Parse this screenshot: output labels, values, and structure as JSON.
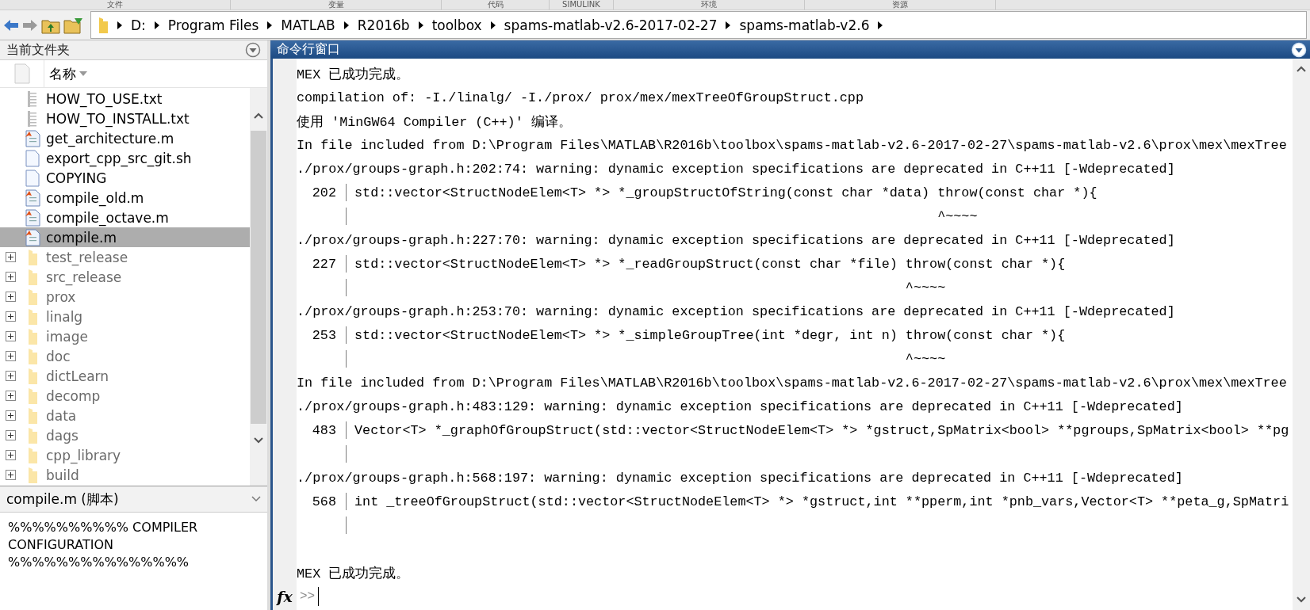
{
  "ribbon_tabs": [
    "文件",
    "变量",
    "代码",
    "SIMULINK",
    "环境",
    "资源"
  ],
  "address_bar": {
    "segments": [
      "D:",
      "Program Files",
      "MATLAB",
      "R2016b",
      "toolbox",
      "spams-matlab-v2.6-2017-02-27",
      "spams-matlab-v2.6"
    ]
  },
  "current_folder": {
    "title": "当前文件夹",
    "column": "名称",
    "items": [
      {
        "name": "HOW_TO_USE.txt",
        "kind": "text",
        "selected": false
      },
      {
        "name": "HOW_TO_INSTALL.txt",
        "kind": "text",
        "selected": false
      },
      {
        "name": "get_architecture.m",
        "kind": "mfile",
        "selected": false
      },
      {
        "name": "export_cpp_src_git.sh",
        "kind": "file",
        "selected": false
      },
      {
        "name": "COPYING",
        "kind": "file",
        "selected": false
      },
      {
        "name": "compile_old.m",
        "kind": "mfile",
        "selected": false
      },
      {
        "name": "compile_octave.m",
        "kind": "mfile",
        "selected": false
      },
      {
        "name": "compile.m",
        "kind": "mfile",
        "selected": true
      },
      {
        "name": "test_release",
        "kind": "folder",
        "selected": false,
        "expanded": false
      },
      {
        "name": "src_release",
        "kind": "folder",
        "selected": false,
        "expanded": false
      },
      {
        "name": "prox",
        "kind": "folder",
        "selected": false,
        "expanded": false
      },
      {
        "name": "linalg",
        "kind": "folder",
        "selected": false,
        "expanded": false
      },
      {
        "name": "image",
        "kind": "folder",
        "selected": false,
        "expanded": false
      },
      {
        "name": "doc",
        "kind": "folder",
        "selected": false,
        "expanded": false
      },
      {
        "name": "dictLearn",
        "kind": "folder",
        "selected": false,
        "expanded": false
      },
      {
        "name": "decomp",
        "kind": "folder",
        "selected": false,
        "expanded": false
      },
      {
        "name": "data",
        "kind": "folder",
        "selected": false,
        "expanded": false
      },
      {
        "name": "dags",
        "kind": "folder",
        "selected": false,
        "expanded": false
      },
      {
        "name": "cpp_library",
        "kind": "folder",
        "selected": false,
        "expanded": false
      },
      {
        "name": "build",
        "kind": "folder",
        "selected": false,
        "expanded": false
      }
    ]
  },
  "details": {
    "title": "compile.m (脚本)",
    "content": "%%%%%%%%%% COMPILER CONFIGURATION %%%%%%%%%%%%%%%"
  },
  "command_window": {
    "title": "命令行窗口",
    "lines": [
      {
        "kind": "text",
        "text": "MEX 已成功完成。"
      },
      {
        "kind": "text",
        "text": "compilation of: -I./linalg/ -I./prox/ prox/mex/mexTreeOfGroupStruct.cpp"
      },
      {
        "kind": "text",
        "text": "使用 'MinGW64 Compiler (C++)' 编译。"
      },
      {
        "kind": "text",
        "text": "In file included from D:\\Program Files\\MATLAB\\R2016b\\toolbox\\spams-matlab-v2.6-2017-02-27\\spams-matlab-v2.6\\prox\\mex\\mexTree"
      },
      {
        "kind": "text",
        "text": "./prox/groups-graph.h:202:74: warning: dynamic exception specifications are deprecated in C++11 [-Wdeprecated]"
      },
      {
        "kind": "code",
        "number": "202",
        "text": "std::vector<StructNodeElem<T> *> *_groupStructOfString(const char *data) throw(const char *){"
      },
      {
        "kind": "marker",
        "text": "                                                                         ^~~~~"
      },
      {
        "kind": "text",
        "text": "./prox/groups-graph.h:227:70: warning: dynamic exception specifications are deprecated in C++11 [-Wdeprecated]"
      },
      {
        "kind": "code",
        "number": "227",
        "text": "std::vector<StructNodeElem<T> *> *_readGroupStruct(const char *file) throw(const char *){"
      },
      {
        "kind": "marker",
        "text": "                                                                     ^~~~~"
      },
      {
        "kind": "text",
        "text": "./prox/groups-graph.h:253:70: warning: dynamic exception specifications are deprecated in C++11 [-Wdeprecated]"
      },
      {
        "kind": "code",
        "number": "253",
        "text": "std::vector<StructNodeElem<T> *> *_simpleGroupTree(int *degr, int n) throw(const char *){"
      },
      {
        "kind": "marker",
        "text": "                                                                     ^~~~~"
      },
      {
        "kind": "text",
        "text": "In file included from D:\\Program Files\\MATLAB\\R2016b\\toolbox\\spams-matlab-v2.6-2017-02-27\\spams-matlab-v2.6\\prox\\mex\\mexTree"
      },
      {
        "kind": "text",
        "text": "./prox/groups-graph.h:483:129: warning: dynamic exception specifications are deprecated in C++11 [-Wdeprecated]"
      },
      {
        "kind": "code",
        "number": "483",
        "text": "Vector<T> *_graphOfGroupStruct(std::vector<StructNodeElem<T> *> *gstruct,SpMatrix<bool> **pgroups,SpMatrix<bool> **pg"
      },
      {
        "kind": "marker"
      },
      {
        "kind": "text",
        "text": "./prox/groups-graph.h:568:197: warning: dynamic exception specifications are deprecated in C++11 [-Wdeprecated]"
      },
      {
        "kind": "code",
        "number": "568",
        "text": "int _treeOfGroupStruct(std::vector<StructNodeElem<T> *> *gstruct,int **pperm,int *pnb_vars,Vector<T> **peta_g,SpMatri"
      },
      {
        "kind": "marker"
      },
      {
        "kind": "blank"
      },
      {
        "kind": "text",
        "text": "MEX 已成功完成。"
      }
    ],
    "fx": "fx",
    "prompt": ">>"
  }
}
